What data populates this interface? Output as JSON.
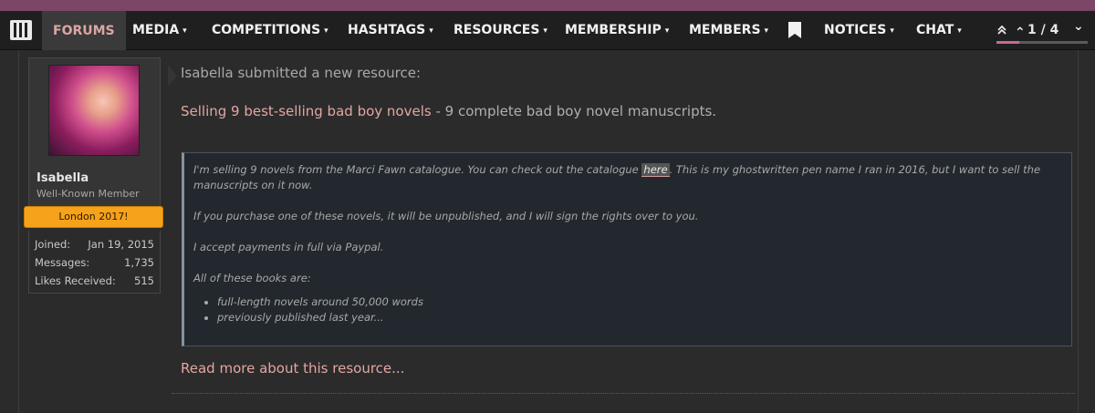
{
  "nav": {
    "items": [
      {
        "label": "FORUMS"
      },
      {
        "label": "MEDIA"
      },
      {
        "label": "COMPETITIONS"
      },
      {
        "label": "HASHTAGS"
      },
      {
        "label": "RESOURCES"
      },
      {
        "label": "MEMBERSHIP"
      },
      {
        "label": "MEMBERS"
      },
      {
        "label": "NOTICES"
      },
      {
        "label": "CHAT"
      }
    ],
    "icons": {
      "logo": "equalizer-logo-icon",
      "bookmark": "bookmark-icon",
      "caret": "caret-down-icon",
      "pager_up": "double-chevron-up-icon",
      "pager_prev": "chevron-up-icon",
      "pager_next": "chevron-down-icon"
    },
    "caret": "▾",
    "pager": {
      "text": "1 / 4",
      "up": "⌃",
      "prev": "⌃",
      "next": "⌄",
      "progress": 0.25
    }
  },
  "user": {
    "name": "Isabella",
    "title": "Well-Known Member",
    "banner": "London 2017!",
    "stats": [
      {
        "label": "Joined:",
        "value": "Jan 19, 2015"
      },
      {
        "label": "Messages:",
        "value": "1,735"
      },
      {
        "label": "Likes Received:",
        "value": "515"
      }
    ]
  },
  "post": {
    "intro": "Isabella submitted a new resource:",
    "resource_link": "Selling 9 best-selling bad boy novels",
    "resource_desc": " - 9 complete bad boy novel manuscripts.",
    "quote": {
      "p1_before": "I'm selling 9 novels from the Marci Fawn catalogue. You can check out the catalogue ",
      "p1_link": "here",
      "p1_after": ". This is my ghostwritten pen name I ran in 2016, but I want to sell the manuscripts on it now.",
      "p2": "If you purchase one of these novels, it will be unpublished, and I will sign the rights over to you.",
      "p3": "I accept payments in full via Paypal.",
      "p4": "All of these books are:",
      "list": [
        "full-length novels around 50,000 words",
        "previously published last year..."
      ]
    },
    "read_more": "Read more about this resource..."
  },
  "colors": {
    "accent": "#7c4669",
    "link": "#e4a6a1",
    "banner": "#f6a21a"
  }
}
